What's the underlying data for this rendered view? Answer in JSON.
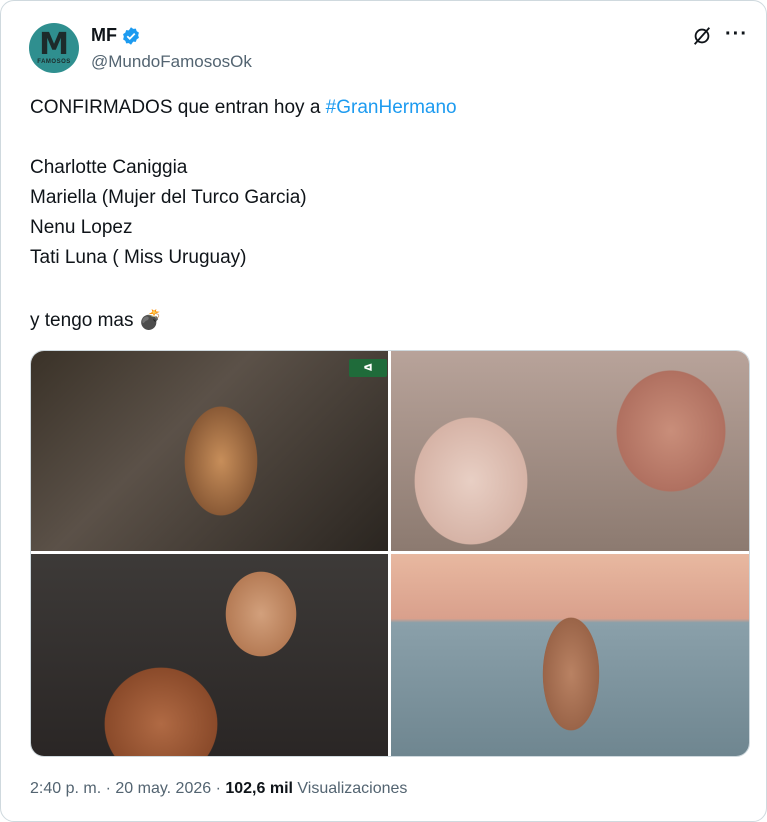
{
  "author": {
    "display_name": "MF",
    "handle": "@MundoFamososOk",
    "avatar_letter": "M",
    "avatar_subtext": "FAMOSOS",
    "verified": true
  },
  "tweet": {
    "line1_prefix": "CONFIRMADOS que entran hoy a ",
    "line1_hashtag": "#GranHermano",
    "names": [
      "Charlotte Caniggia",
      "Mariella (Mujer del Turco Garcia)",
      "Nenu Lopez",
      "Tati Luna ( Miss Uruguay)"
    ],
    "closing": "y tengo mas",
    "closing_emoji": "💣"
  },
  "photos": [
    "photo-1",
    "photo-2",
    "photo-3",
    "photo-4"
  ],
  "exit_sign": "ᐊ",
  "meta": {
    "time": "2:40 p. m.",
    "separator": " · ",
    "date": "20 may. 2026",
    "views_count": "102,6 mil",
    "views_label": "Visualizaciones"
  },
  "colors": {
    "hashtag": "#1d9bf0",
    "verified_badge": "#1d9bf0",
    "secondary_text": "#536471"
  },
  "icons": {
    "grok": "grok-icon",
    "more": "more-icon",
    "verified": "verified-badge-icon"
  }
}
